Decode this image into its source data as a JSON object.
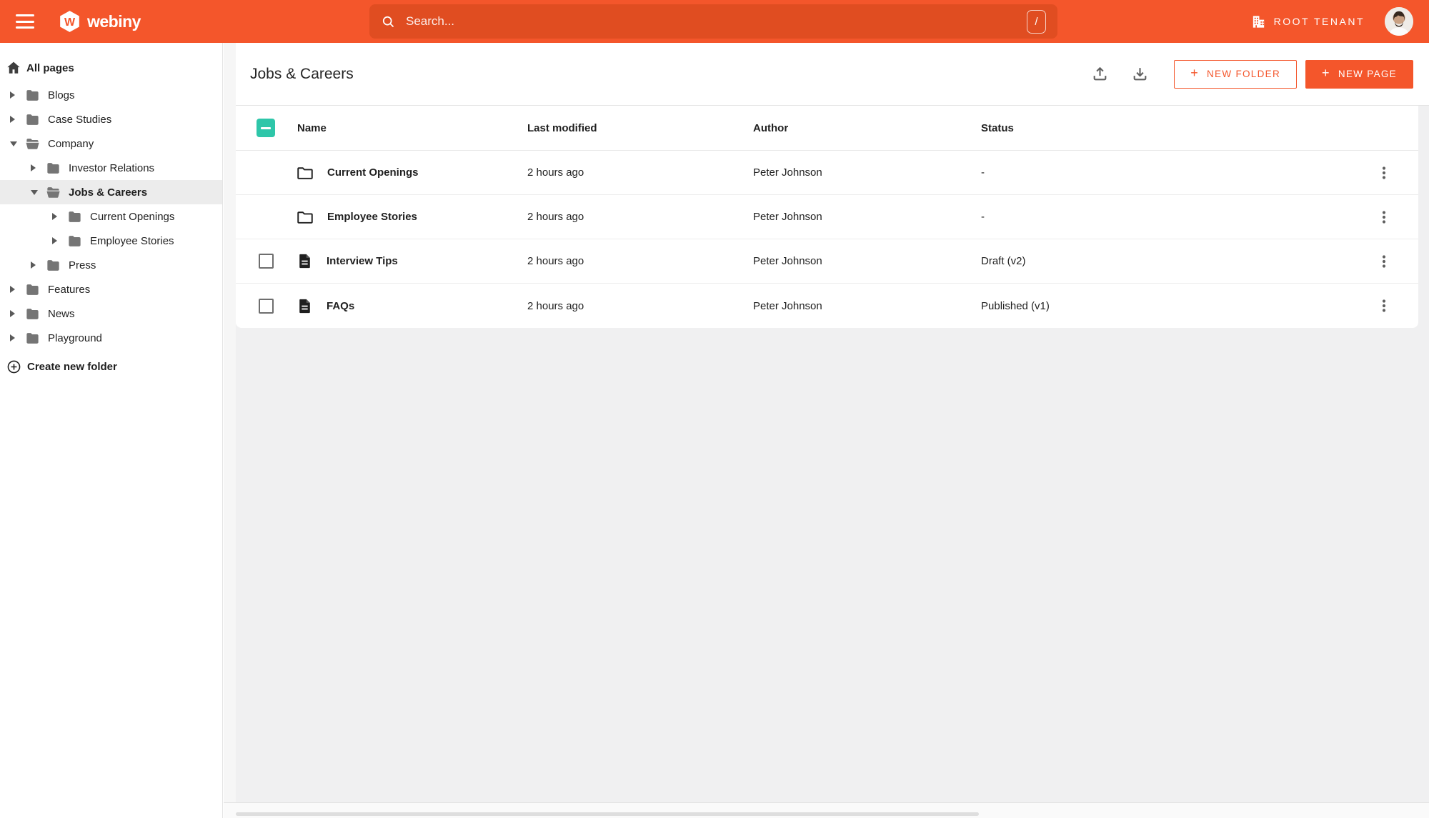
{
  "topbar": {
    "brand": "webiny",
    "search": {
      "placeholder": "Search...",
      "shortcut_key": "/"
    },
    "tenant_label": "ROOT TENANT"
  },
  "sidebar": {
    "all_pages": "All pages",
    "items": [
      {
        "label": "Blogs",
        "level": 1,
        "state": "collapsed"
      },
      {
        "label": "Case Studies",
        "level": 1,
        "state": "collapsed"
      },
      {
        "label": "Company",
        "level": 1,
        "state": "expanded"
      },
      {
        "label": "Investor Relations",
        "level": 2,
        "state": "collapsed"
      },
      {
        "label": "Jobs & Careers",
        "level": 2,
        "state": "expanded",
        "selected": true
      },
      {
        "label": "Current Openings",
        "level": 3,
        "state": "collapsed"
      },
      {
        "label": "Employee Stories",
        "level": 3,
        "state": "collapsed"
      },
      {
        "label": "Press",
        "level": 2,
        "state": "collapsed"
      },
      {
        "label": "Features",
        "level": 1,
        "state": "collapsed"
      },
      {
        "label": "News",
        "level": 1,
        "state": "collapsed"
      },
      {
        "label": "Playground",
        "level": 1,
        "state": "collapsed"
      }
    ],
    "create_new_folder": "Create new folder"
  },
  "main": {
    "title": "Jobs & Careers",
    "actions": {
      "plus_glyph": "+",
      "new_folder": "NEW FOLDER",
      "new_page": "NEW PAGE"
    },
    "table": {
      "columns": [
        "Name",
        "Last modified",
        "Author",
        "Status"
      ],
      "rows": [
        {
          "type": "folder",
          "name": "Current Openings",
          "modified": "2 hours ago",
          "author": "Peter Johnson",
          "status": "-"
        },
        {
          "type": "folder",
          "name": "Employee Stories",
          "modified": "2 hours ago",
          "author": "Peter Johnson",
          "status": "-"
        },
        {
          "type": "page",
          "name": "Interview Tips",
          "modified": "2 hours ago",
          "author": "Peter Johnson",
          "status": "Draft (v2)"
        },
        {
          "type": "page",
          "name": "FAQs",
          "modified": "2 hours ago",
          "author": "Peter Johnson",
          "status": "Published (v1)"
        }
      ]
    }
  },
  "colors": {
    "accent_orange": "#f4562b",
    "search_bar_orange": "#e04d21",
    "select_all_teal": "#2ec6a9"
  },
  "icons": [
    "hamburger-menu-icon",
    "webiny-logo",
    "search-icon",
    "slash-key-icon",
    "building-icon",
    "user-avatar",
    "home-icon",
    "folder-closed-icon",
    "folder-open-icon",
    "chevron-right-icon",
    "chevron-down-icon",
    "plus-circle-icon",
    "upload-icon",
    "download-icon",
    "folder-outline-icon",
    "page-icon",
    "kebab-menu-icon",
    "indeterminate-checkbox"
  ]
}
